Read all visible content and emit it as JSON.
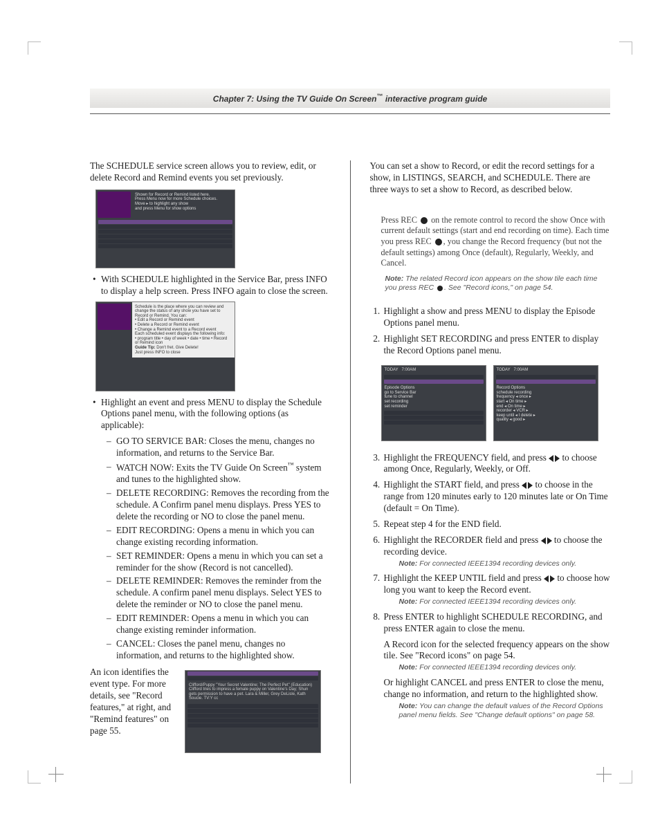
{
  "header": {
    "chapter": "Chapter 7: Using the TV Guide On Screen",
    "tm": "™",
    "suffix": " interactive program guide"
  },
  "left": {
    "intro": "The SCHEDULE service screen allows you to review, edit, or delete Record and Remind events you set previously.",
    "b1": "With SCHEDULE highlighted in the Service Bar, press INFO to display a help screen. Press INFO again to close the screen.",
    "b2": "Highlight an event and press MENU to display the Schedule Options panel menu, with the following options (as applicable):",
    "d1": "GO TO SERVICE BAR: Closes the menu, changes no information, and returns to the Service Bar.",
    "d2_a": "WATCH NOW: Exits the TV Guide On Screen",
    "d2_b": " system and tunes to the highlighted show.",
    "d3": "DELETE RECORDING: Removes the recording from the schedule. A Confirm panel menu displays. Press YES to delete the recording or NO to close the panel menu.",
    "d4": "EDIT RECORDING: Opens a menu in which you can change existing recording information.",
    "d5": "SET REMINDER: Opens a menu in which you can set a reminder for the show (Record is not cancelled).",
    "d6": "DELETE REMINDER: Removes the reminder from the schedule. A confirm panel menu displays. Select YES to delete the reminder or NO to close the panel menu.",
    "d7": "EDIT REMINDER: Opens a menu in which you can change existing reminder information.",
    "d8": "CANCEL: Closes the panel menu, changes no information, and returns to the highlighted show.",
    "foot": "An icon identifies the event type. For more details, see \"Record features,\" at right, and \"Remind features\" on page 55."
  },
  "right": {
    "intro": "You can set a show to Record, or edit the record settings for a show, in LISTINGS, SEARCH, and SCHEDULE. There are three ways to set a show to Record, as described below.",
    "mA1": "Press REC ",
    "mA2": " on the remote control to record the show Once with current default settings (start and end recording on time). Each time you press REC ",
    "mA3": ", you change the Record frequency (but not the default settings) among Once (default), Regularly, Weekly, and Cancel.",
    "noteA1": "The related Record icon appears on the show tile each time you press REC ",
    "noteA2": ". See \"Record icons,\" on page 54.",
    "s1": "Highlight a show and press MENU to display the Episode Options panel menu.",
    "s2": "Highlight SET RECORDING and press ENTER to display the Record Options panel menu.",
    "s3a": "Highlight the FREQUENCY field, and press ",
    "s3b": " to choose among Once, Regularly, Weekly, or Off.",
    "s4a": "Highlight the START field, and press ",
    "s4b": " to choose in the range from 120 minutes early to 120 minutes late or On Time (default = On Time).",
    "s5": "Repeat step 4 for the END field.",
    "s6a": "Highlight the RECORDER field and press ",
    "s6b": " to choose the recording device.",
    "note6": "For connected IEEE1394 recording devices only.",
    "s7a": "Highlight the KEEP UNTIL field and press ",
    "s7b": " to choose how long you want to keep the Record event.",
    "note7": "For connected IEEE1394 recording devices only.",
    "s8a": "Press ENTER to highlight SCHEDULE RECORDING, and press ENTER again to close the menu.",
    "s8b": "A Record icon for the selected frequency appears on the show tile. See \"Record icons\" on page 54.",
    "note8a": "For connected IEEE1394 recording devices only.",
    "s8c": "Or highlight CANCEL and press ENTER to close the menu, change no information, and return to the highlighted show.",
    "note8b": "You can change the default values of the Record Options panel menu fields. See \"Change default options\" on page 58."
  },
  "labels": {
    "note": "Note:"
  }
}
